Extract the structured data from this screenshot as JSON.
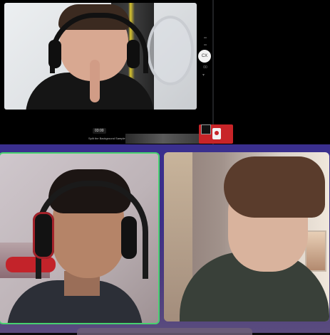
{
  "top_panel": {
    "timer": "03:00",
    "caption_strip": "Split the Background Sample • bold",
    "controls": {
      "zoom_label": "CX",
      "zoom_sub_label": "00"
    }
  },
  "record_control": {
    "stop_label": "",
    "record_label": ""
  },
  "participants": [
    {
      "name": "",
      "speaking": true
    },
    {
      "name": "",
      "speaking": false
    }
  ],
  "colors": {
    "speaking_border": "#47d16f",
    "record_red": "#c82428",
    "call_bg_top": "#3a2f8e",
    "call_bg_bottom": "#5a4c7e"
  }
}
